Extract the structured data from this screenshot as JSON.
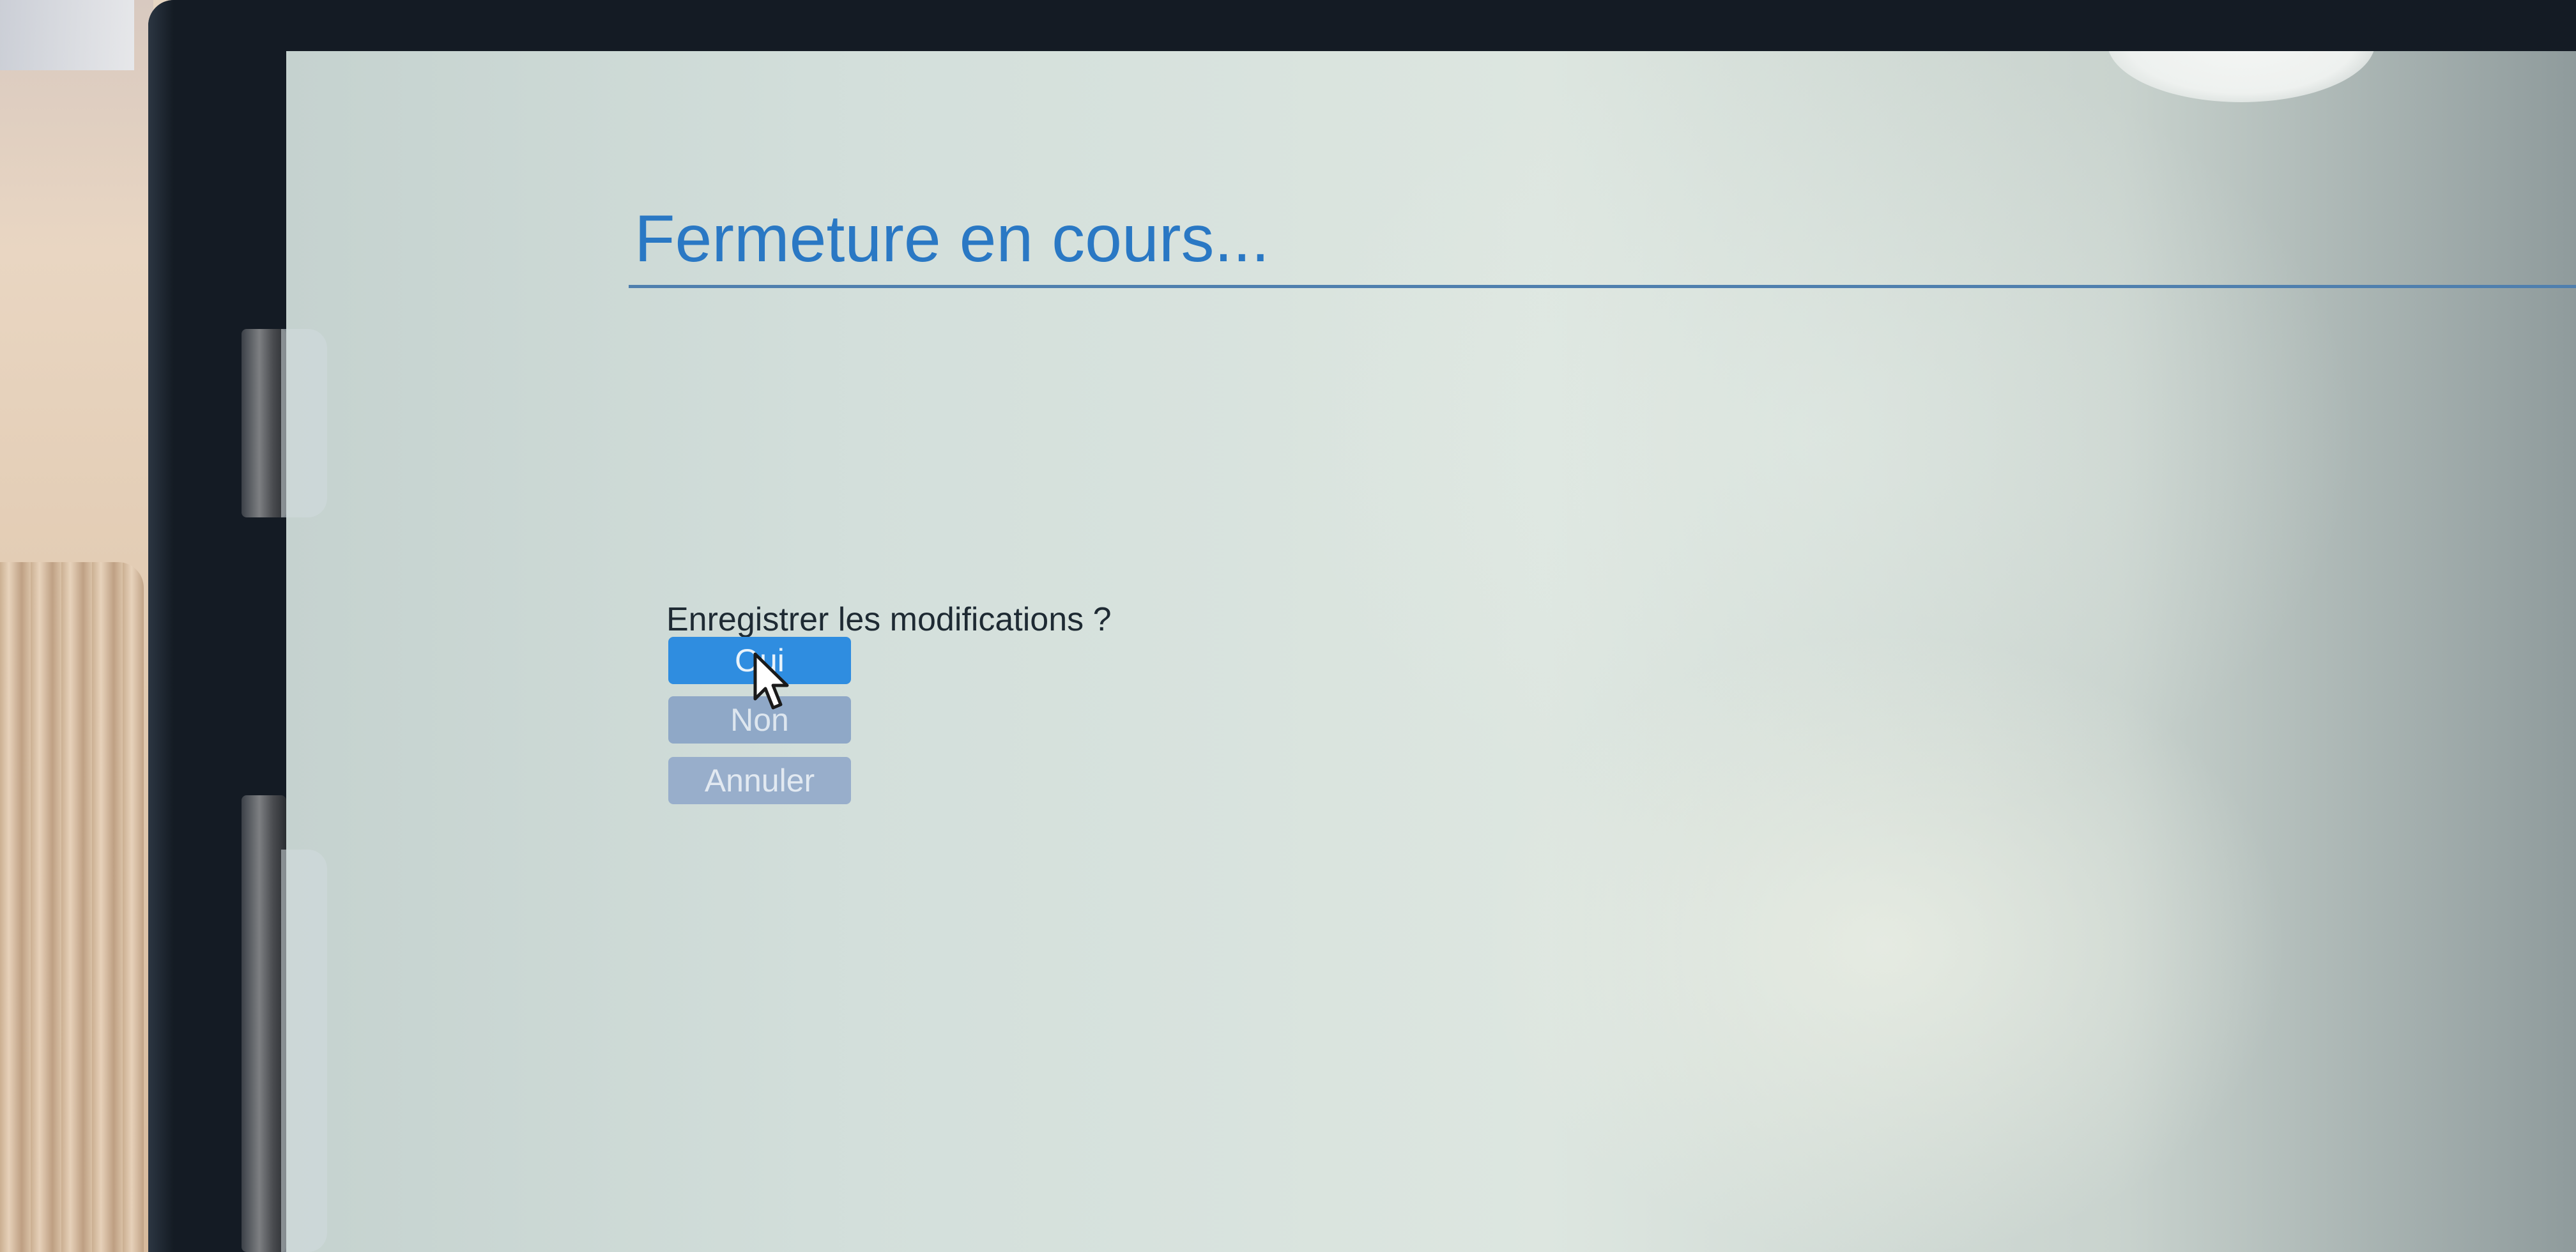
{
  "dialog": {
    "title": "Fermeture en cours...",
    "prompt": "Enregistrer les modifications ?",
    "buttons": {
      "yes_label": "Oui",
      "no_label": "Non",
      "cancel_label": "Annuler"
    }
  },
  "icons": {
    "cursor": "mouse-pointer-icon"
  },
  "colors": {
    "title": "#2a78c4",
    "title_rule": "#4f7fae",
    "primary_button": "#2f8de0",
    "secondary_button": "#8fa8c7",
    "tertiary_button": "#98aecb",
    "prompt_text": "#1e2a33",
    "screen_background": "#d3dfdb",
    "bezel": "#141b24"
  }
}
